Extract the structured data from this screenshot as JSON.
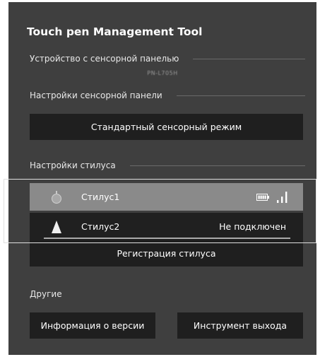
{
  "app": {
    "title": "Touch pen Management Tool"
  },
  "device_section": {
    "label": "Устройство с сенсорной панелью",
    "device_id": "PN-L705H"
  },
  "touch_settings_section": {
    "label": "Настройки сенсорной панели",
    "mode_button": "Стандартный сенсорный режим"
  },
  "stylus_section": {
    "label": "Настройки стилуса",
    "pens": [
      {
        "name": "Стилус1",
        "status": "",
        "icon": "pen-tip-round-icon",
        "battery_icon": "battery-icon",
        "signal_icon": "signal-strength-icon"
      },
      {
        "name": "Стилус2",
        "status": "Не подключен",
        "icon": "pen-tip-triangle-icon"
      }
    ],
    "register_button": "Регистрация стилуса"
  },
  "other_section": {
    "label": "Другие",
    "version_button": "Информация о версии",
    "exit_button": "Инструмент выхода"
  },
  "colors": {
    "background": "#3f3f3f",
    "button": "#1f1f1f",
    "selected_row": "#8a8a8a",
    "text": "#ffffff"
  }
}
